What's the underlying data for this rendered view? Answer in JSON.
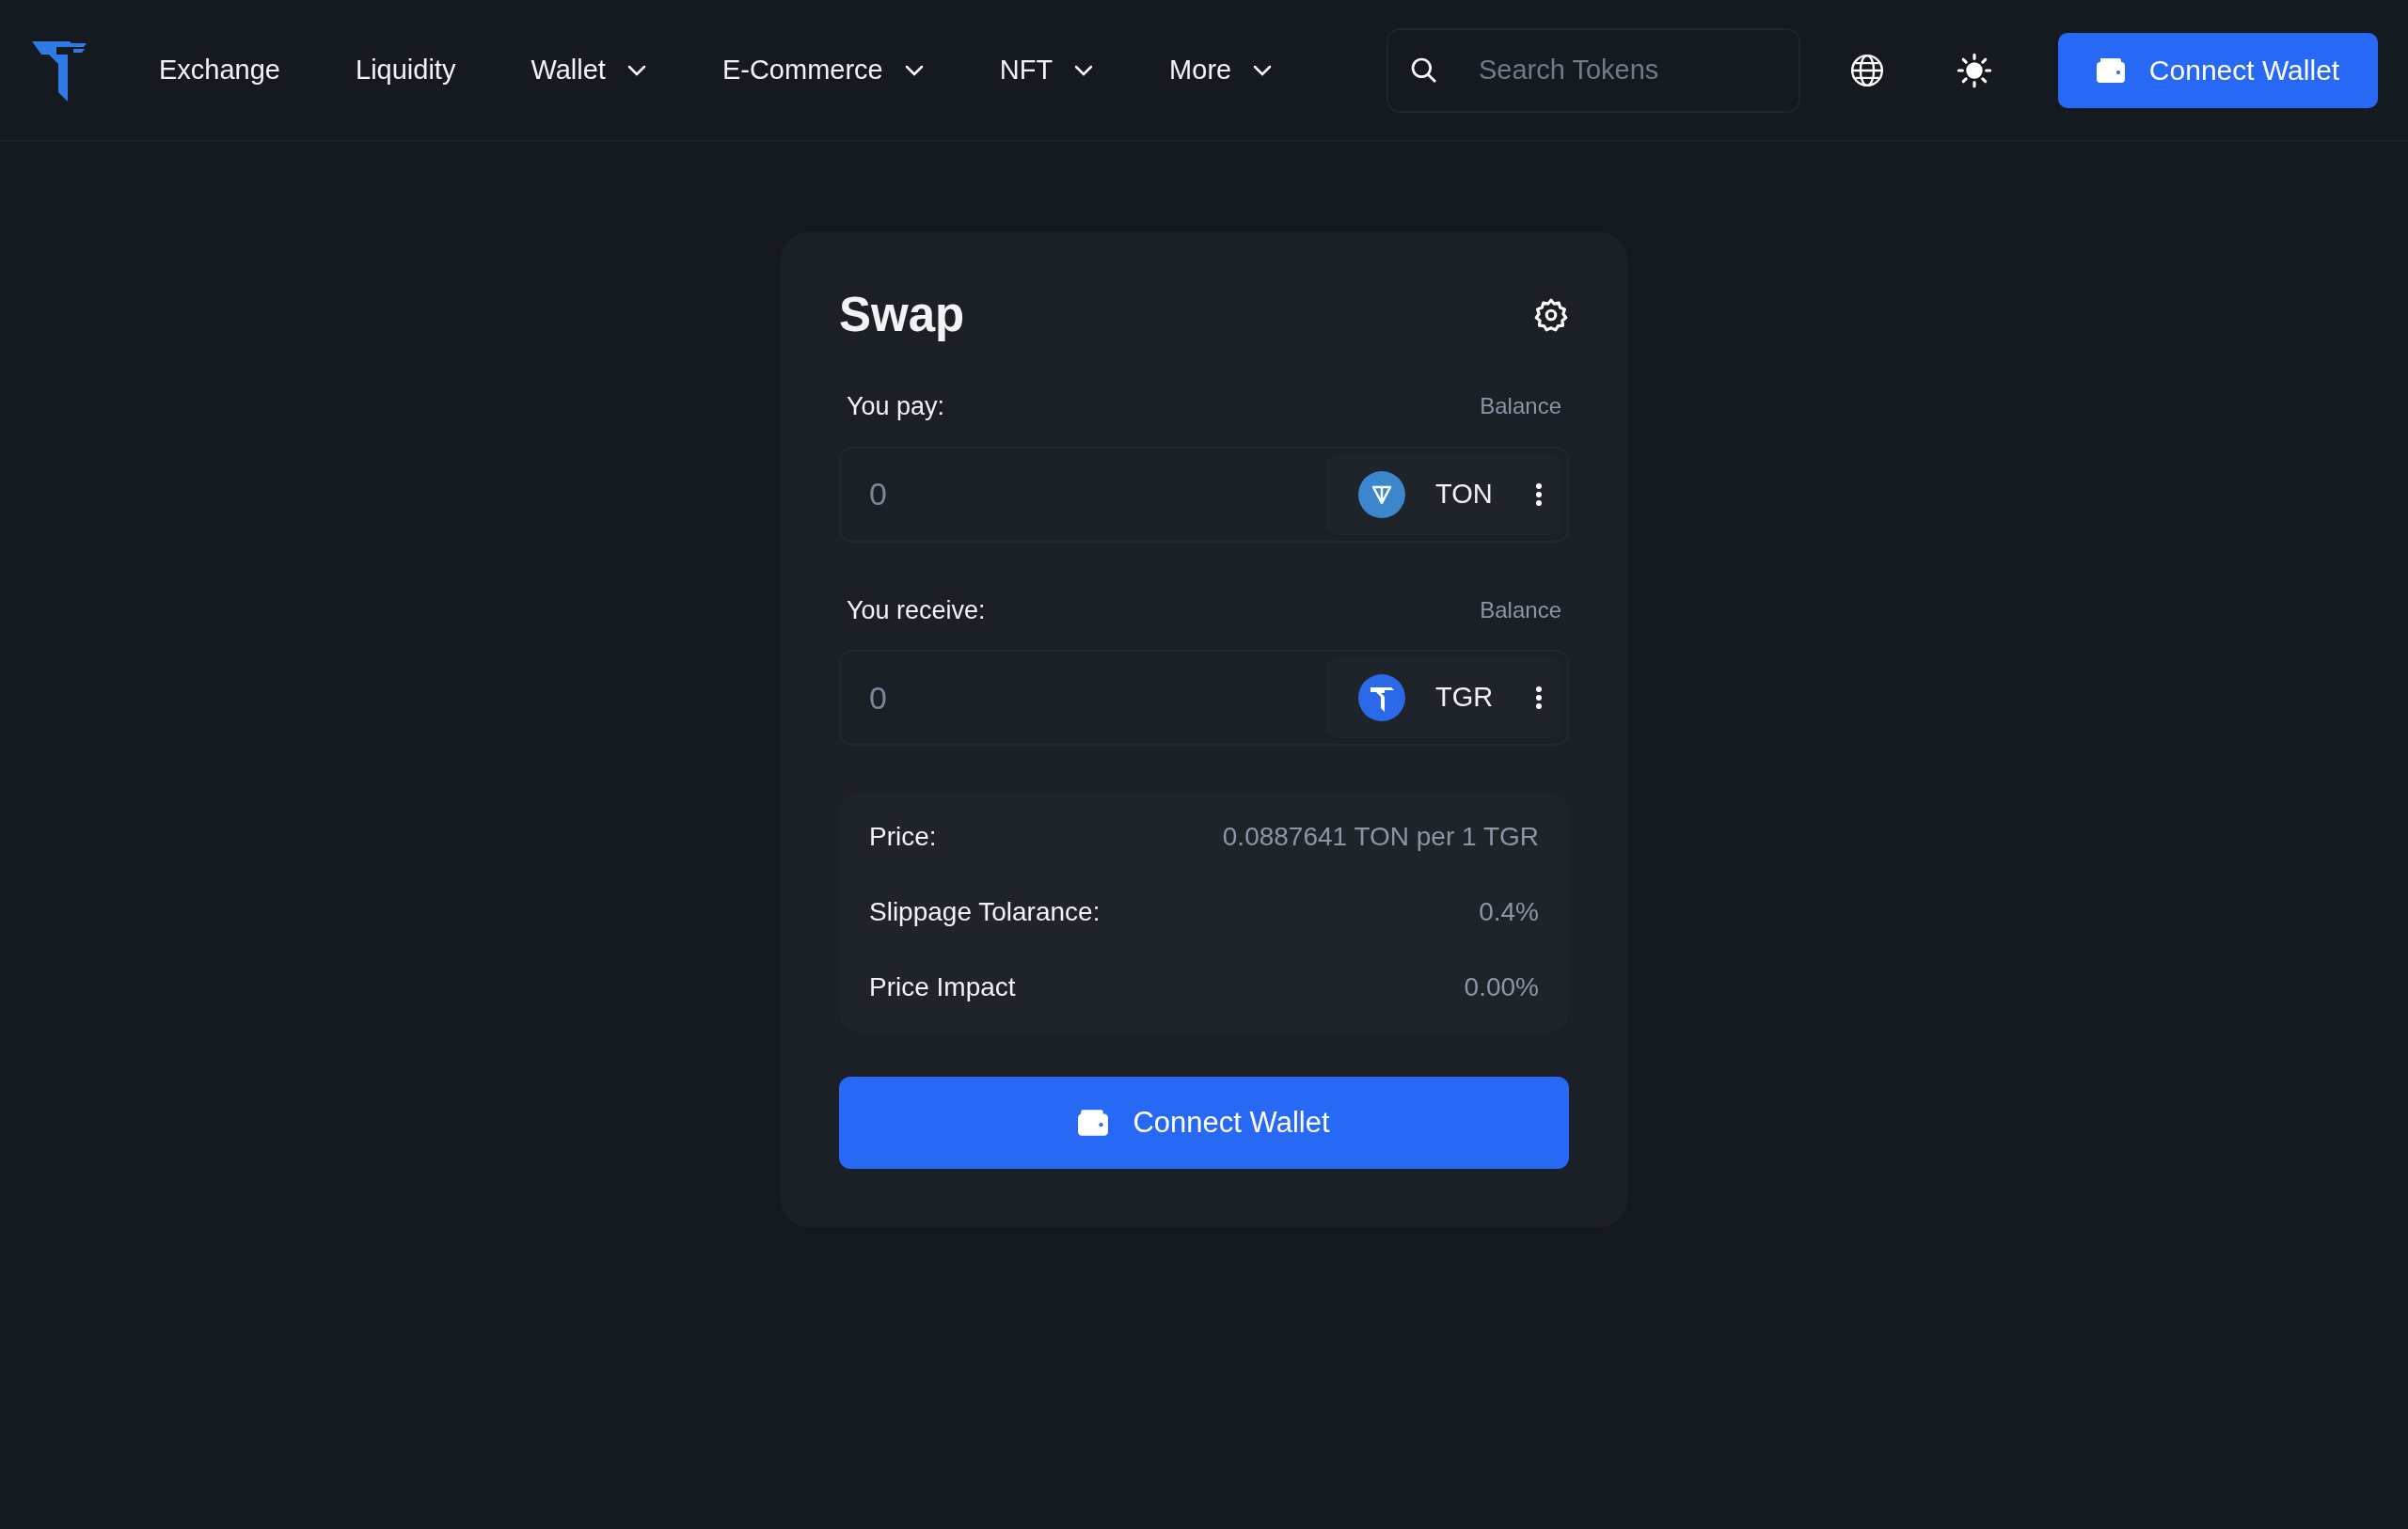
{
  "header": {
    "nav": [
      {
        "label": "Exchange",
        "dropdown": false
      },
      {
        "label": "Liquidity",
        "dropdown": false
      },
      {
        "label": "Wallet",
        "dropdown": true
      },
      {
        "label": "E-Commerce",
        "dropdown": true
      },
      {
        "label": "NFT",
        "dropdown": true
      },
      {
        "label": "More",
        "dropdown": true
      }
    ],
    "search": {
      "placeholder": "Search Tokens"
    },
    "connect_button": "Connect Wallet"
  },
  "swap": {
    "title": "Swap",
    "fields": [
      {
        "label": "You pay:",
        "balance": "Balance",
        "placeholder": "0",
        "token": {
          "kind": "ton",
          "symbol": "TON"
        }
      },
      {
        "label": "You receive:",
        "balance": "Balance",
        "placeholder": "0",
        "token": {
          "kind": "tgr",
          "symbol": "TGR"
        }
      }
    ],
    "details": [
      {
        "label": "Price:",
        "value": "0.0887641 TON per 1 TGR"
      },
      {
        "label": "Slippage Tolarance:",
        "value": "0.4%"
      },
      {
        "label": "Price Impact",
        "value": "0.00%"
      }
    ],
    "connect_button": "Connect Wallet"
  }
}
